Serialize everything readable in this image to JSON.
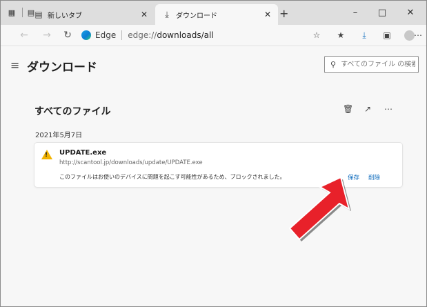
{
  "tabs": [
    {
      "label": "新しいタブ",
      "icon": "new-tab-icon",
      "active": false
    },
    {
      "label": "ダウンロード",
      "icon": "download-icon",
      "active": true
    }
  ],
  "address": {
    "brand": "Edge",
    "url_scheme": "edge://",
    "url_path": "downloads/all"
  },
  "page": {
    "title": "ダウンロード",
    "search_placeholder": "すべてのファイル の検索",
    "section_title": "すべてのファイル",
    "date": "2021年5月7日"
  },
  "download": {
    "file_name": "UPDATE.exe",
    "url": "http://scantool.jp/downloads/update/UPDATE.exe",
    "message": "このファイルはお使いのデバイスに問題を起こす可能性があるため、ブロックされました。",
    "keep_label": "保存",
    "delete_label": "削除"
  },
  "colors": {
    "accent": "#0f6cbd",
    "warning": "#f2b300",
    "callout_arrow": "#e8212a"
  }
}
